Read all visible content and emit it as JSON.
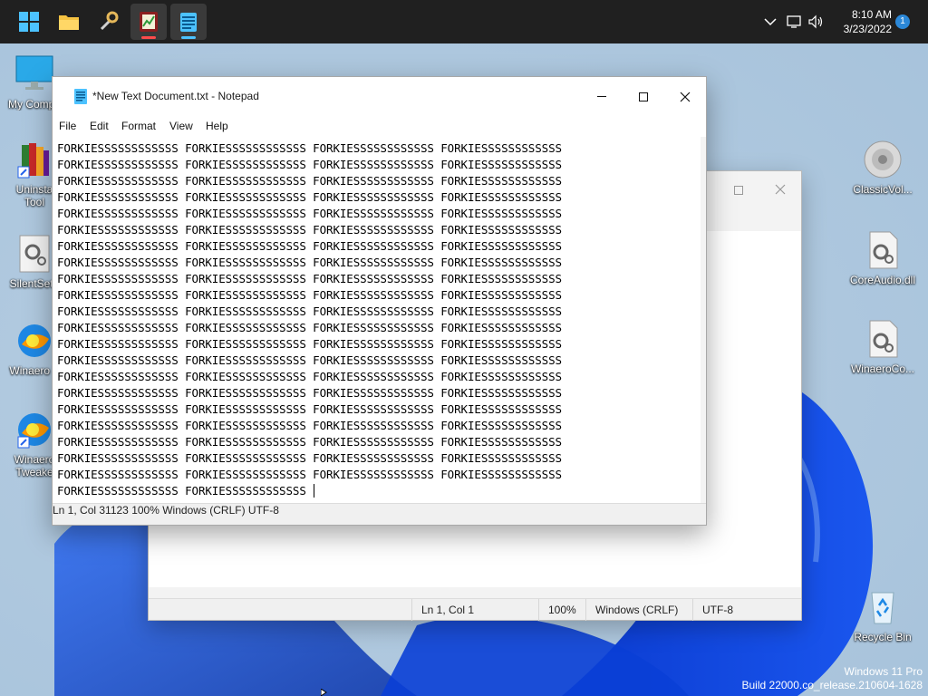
{
  "taskbar": {
    "pinned": [
      {
        "name": "start-button",
        "icon": "windows-logo-icon"
      },
      {
        "name": "file-explorer",
        "icon": "folder-icon"
      },
      {
        "name": "tweaker-app",
        "icon": "wrench-icon"
      },
      {
        "name": "red-app",
        "icon": "chart-app-icon"
      },
      {
        "name": "notepad-app",
        "icon": "notepad-icon"
      }
    ],
    "clock": {
      "time": "8:10 AM",
      "date": "3/23/2022"
    },
    "notification_count": "1",
    "tray_icons": [
      "chevron-up-icon",
      "network-icon",
      "volume-icon"
    ]
  },
  "desktop_icons": [
    {
      "label": "My Compu",
      "icon": "monitor-icon"
    },
    {
      "label": "Uninsta",
      "label2": "Tool",
      "icon": "uninstall-tool-icon"
    },
    {
      "label": "SilentSetu",
      "icon": "gear-file-icon"
    },
    {
      "label": "Winaero T",
      "icon": "winaero-icon"
    },
    {
      "label": "Winaero",
      "label2": "Tweake",
      "icon": "winaero-shortcut-icon"
    },
    {
      "label": "ClassicVol...",
      "icon": "speaker-icon"
    },
    {
      "label": "CoreAudio.dll",
      "icon": "gear-file-icon"
    },
    {
      "label": "WinaeroCo...",
      "icon": "gear-file-icon"
    },
    {
      "label": "Recycle Bin",
      "icon": "recycle-bin-icon"
    }
  ],
  "front_window": {
    "title": "*New Text Document.txt - Notepad",
    "menu": [
      "File",
      "Edit",
      "Format",
      "View",
      "Help"
    ],
    "line_full": "FORKIESSSSSSSSSSSS FORKIESSSSSSSSSSSS FORKIESSSSSSSSSSSS FORKIESSSSSSSSSSSS",
    "line_last": "FORKIESSSSSSSSSSSS FORKIESSSSSSSSSSSS ",
    "line_count": 21,
    "status": {
      "position": "Ln 1, Col 31123",
      "zoom": "100%",
      "eol": "Windows (CRLF)",
      "encoding": "UTF-8"
    }
  },
  "back_window": {
    "status": {
      "position": "Ln 1, Col 1",
      "zoom": "100%",
      "eol": "Windows (CRLF)",
      "encoding": "UTF-8"
    }
  },
  "watermark": {
    "line1": "Windows 11 Pro",
    "line2": "Build 22000.co_release.210604-1628"
  },
  "colors": {
    "taskbar": "#202020",
    "accent": "#4cc2ff",
    "badge": "#2b88d8",
    "wallpaper_blue": "#0a3fd6"
  }
}
